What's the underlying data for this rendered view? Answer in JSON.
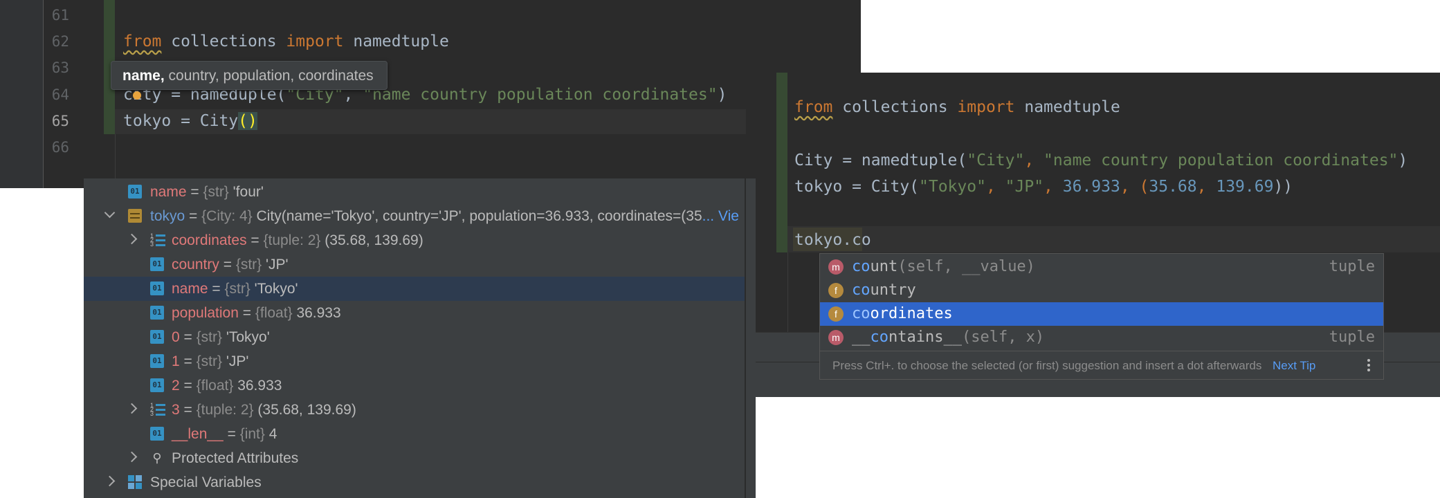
{
  "editor_left": {
    "line_numbers": [
      "61",
      "62",
      "63",
      "64",
      "65",
      "66"
    ],
    "line62": {
      "kw_from": "from",
      "mod": " collections ",
      "kw_import": "import",
      "name": " namedtuple"
    },
    "line64": {
      "prefix": "city = named",
      "mid": "uple(",
      "str1": "\"City\"",
      "comma": ", ",
      "str2": "\"name country population coordinates\"",
      "end": ")"
    },
    "line65": {
      "code": "tokyo = City",
      "parens": "()"
    },
    "tooltip": {
      "bold": "name,",
      "rest": " country, population, coordinates"
    }
  },
  "editor_right": {
    "line1": {
      "kw_from": "from",
      "mod": " collections ",
      "kw_import": "import",
      "name": " namedtuple"
    },
    "line3": {
      "prefix": "City = namedtuple(",
      "str1": "\"City\"",
      "comma": ", ",
      "str2": "\"name country population coordinates\"",
      "end": ")"
    },
    "line4": {
      "prefix": "tokyo = City(",
      "s1": "\"Tokyo\"",
      "c1": ", ",
      "s2": "\"JP\"",
      "c2": ", ",
      "n1": "36.933",
      "c3": ", (",
      "n2": "35.68",
      "c4": ", ",
      "n3": "139.69",
      "end": "))"
    },
    "line6": {
      "typed": "tokyo.co"
    }
  },
  "completion": {
    "items": [
      {
        "badge": "m",
        "match": "co",
        "rest": "unt",
        "args": "(self, __value)",
        "type": "tuple"
      },
      {
        "badge": "f",
        "match": "co",
        "rest": "untry",
        "args": "",
        "type": ""
      },
      {
        "badge": "f",
        "match": "co",
        "rest": "ordinates",
        "args": "",
        "type": ""
      },
      {
        "badge": "m",
        "pre": "__",
        "match": "co",
        "rest": "ntains__",
        "args": "(self, x)",
        "type": "tuple"
      }
    ],
    "hint": "Press Ctrl+. to choose the selected (or first) suggestion and insert a dot afterwards",
    "next_tip": "Next Tip"
  },
  "variables": {
    "rows": [
      {
        "name": "name",
        "type": "{str}",
        "value": "'four'"
      },
      {
        "name": "tokyo",
        "type": "{City: 4}",
        "value": "City(name='Tokyo', country='JP', population=36.933, coordinates=(35",
        "link": "... View"
      },
      {
        "name": "coordinates",
        "type": "{tuple: 2}",
        "value": "(35.68, 139.69)"
      },
      {
        "name": "country",
        "type": "{str}",
        "value": "'JP'"
      },
      {
        "name": "name",
        "type": "{str}",
        "value": "'Tokyo'"
      },
      {
        "name": "population",
        "type": "{float}",
        "value": "36.933"
      },
      {
        "name": "0",
        "type": "{str}",
        "value": "'Tokyo'"
      },
      {
        "name": "1",
        "type": "{str}",
        "value": "'JP'"
      },
      {
        "name": "2",
        "type": "{float}",
        "value": "36.933"
      },
      {
        "name": "3",
        "type": "{tuple: 2}",
        "value": "(35.68, 139.69)"
      },
      {
        "name": "__len__",
        "type": "{int}",
        "value": "4"
      },
      {
        "label": "Protected Attributes"
      },
      {
        "label": "Special Variables"
      }
    ]
  }
}
